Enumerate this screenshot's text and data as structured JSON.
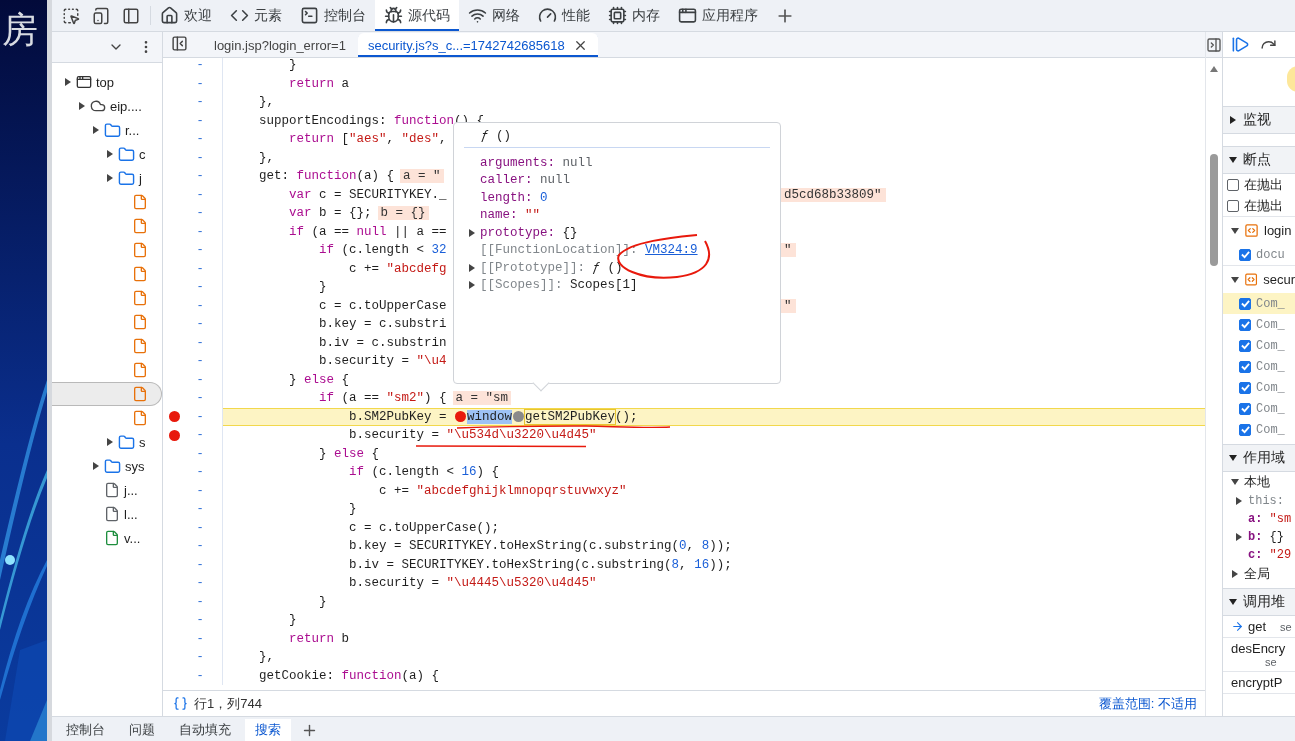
{
  "desktop": {
    "glyph": "房"
  },
  "toolbar": {
    "tabs": [
      {
        "kind": "welcome",
        "label": "欢迎",
        "selected": false
      },
      {
        "kind": "elements",
        "label": "元素",
        "selected": false
      },
      {
        "kind": "console",
        "label": "控制台",
        "selected": false
      },
      {
        "kind": "sources",
        "label": "源代码",
        "selected": true
      },
      {
        "kind": "network",
        "label": "网络",
        "selected": false
      },
      {
        "kind": "performance",
        "label": "性能",
        "selected": false
      },
      {
        "kind": "memory",
        "label": "内存",
        "selected": false
      },
      {
        "kind": "application",
        "label": "应用程序",
        "selected": false
      }
    ]
  },
  "navigator": {
    "tree": [
      {
        "kind": "frame",
        "label": "top",
        "selected": false,
        "children": [
          {
            "kind": "domain",
            "label": "eip....",
            "selected": false,
            "children": [
              {
                "kind": "folder",
                "label": "r...",
                "selected": false,
                "children": [
                  {
                    "kind": "folder",
                    "label": "c",
                    "selected": false
                  },
                  {
                    "kind": "folder",
                    "label": "j",
                    "selected": false,
                    "children": [
                      {
                        "kind": "file",
                        "color": "#e8710a",
                        "selected": false
                      },
                      {
                        "kind": "file",
                        "color": "#e8710a",
                        "selected": false
                      },
                      {
                        "kind": "file",
                        "color": "#e8710a",
                        "selected": false
                      },
                      {
                        "kind": "file",
                        "color": "#e8710a",
                        "selected": false
                      },
                      {
                        "kind": "file",
                        "color": "#e8710a",
                        "selected": false
                      },
                      {
                        "kind": "file",
                        "color": "#e8710a",
                        "selected": false
                      },
                      {
                        "kind": "file",
                        "color": "#e8710a",
                        "selected": false
                      },
                      {
                        "kind": "file",
                        "color": "#e8710a",
                        "selected": false
                      },
                      {
                        "kind": "file",
                        "color": "#e8710a",
                        "selected": true
                      },
                      {
                        "kind": "file",
                        "color": "#e8710a",
                        "selected": false
                      }
                    ]
                  },
                  {
                    "kind": "folder",
                    "label": "s",
                    "selected": false
                  }
                ]
              },
              {
                "kind": "folder",
                "label": "sys",
                "selected": false
              },
              {
                "kind": "file",
                "label": "j...",
                "color": "#5f6368",
                "selected": false
              },
              {
                "kind": "file",
                "label": "l...",
                "color": "#5f6368",
                "selected": false
              },
              {
                "kind": "file",
                "label": "v...",
                "color": "#1e8e3e",
                "selected": false
              }
            ]
          }
        ]
      }
    ]
  },
  "editor": {
    "tabs": [
      {
        "label": "login.jsp?login_error=1",
        "selected": false
      },
      {
        "label": "security.js?s_c...=1742742685618",
        "selected": true
      }
    ],
    "lines": [
      {
        "gutter": "-",
        "breakpoint": false,
        "current": false,
        "tokens": [
          {
            "kind": "plain",
            "text": "        }"
          }
        ]
      },
      {
        "gutter": "-",
        "breakpoint": false,
        "current": false,
        "tokens": [
          {
            "kind": "keyword",
            "text": "        return"
          },
          {
            "kind": "plain",
            "text": " a"
          }
        ]
      },
      {
        "gutter": "-",
        "breakpoint": false,
        "current": false,
        "tokens": [
          {
            "kind": "plain",
            "text": "    },"
          }
        ]
      },
      {
        "gutter": "-",
        "breakpoint": false,
        "current": false,
        "tokens": [
          {
            "kind": "plain",
            "text": "    supportEncodings: "
          },
          {
            "kind": "keyword",
            "text": "function"
          },
          {
            "kind": "plain",
            "text": "() {"
          }
        ]
      },
      {
        "gutter": "-",
        "breakpoint": false,
        "current": false,
        "tokens": [
          {
            "kind": "keyword",
            "text": "        return"
          },
          {
            "kind": "plain",
            "text": " ["
          },
          {
            "kind": "string",
            "text": "\"aes\""
          },
          {
            "kind": "plain",
            "text": ", "
          },
          {
            "kind": "string",
            "text": "\"des\""
          },
          {
            "kind": "plain",
            "text": ","
          }
        ]
      },
      {
        "gutter": "-",
        "breakpoint": false,
        "current": false,
        "tokens": [
          {
            "kind": "plain",
            "text": "    },"
          }
        ]
      },
      {
        "gutter": "-",
        "breakpoint": false,
        "current": false,
        "tokens": [
          {
            "kind": "plain",
            "text": "    get: "
          },
          {
            "kind": "keyword",
            "text": "function"
          },
          {
            "kind": "plain",
            "text": "(a) {"
          },
          {
            "kind": "value",
            "text": "a = \""
          }
        ]
      },
      {
        "gutter": "-",
        "breakpoint": false,
        "current": false,
        "tokens": [
          {
            "kind": "keyword",
            "text": "        var"
          },
          {
            "kind": "plain",
            "text": " c = SECURITYKEY._"
          },
          {
            "kind": "far-value",
            "text": "d5cd68b33809\""
          }
        ]
      },
      {
        "gutter": "-",
        "breakpoint": false,
        "current": false,
        "tokens": [
          {
            "kind": "keyword",
            "text": "        var"
          },
          {
            "kind": "plain",
            "text": " b = {};"
          },
          {
            "kind": "value",
            "text": "b = {}"
          }
        ]
      },
      {
        "gutter": "-",
        "breakpoint": false,
        "current": false,
        "tokens": [
          {
            "kind": "keyword",
            "text": "        if"
          },
          {
            "kind": "plain",
            "text": " (a == "
          },
          {
            "kind": "keyword",
            "text": "null"
          },
          {
            "kind": "plain",
            "text": " || a =="
          }
        ]
      },
      {
        "gutter": "-",
        "breakpoint": false,
        "current": false,
        "tokens": [
          {
            "kind": "keyword",
            "text": "            if"
          },
          {
            "kind": "plain",
            "text": " (c.length < "
          },
          {
            "kind": "number",
            "text": "32"
          },
          {
            "kind": "far-value",
            "text": "\""
          }
        ]
      },
      {
        "gutter": "-",
        "breakpoint": false,
        "current": false,
        "tokens": [
          {
            "kind": "plain",
            "text": "                c += "
          },
          {
            "kind": "string",
            "text": "\"abcdefg"
          }
        ]
      },
      {
        "gutter": "-",
        "breakpoint": false,
        "current": false,
        "tokens": [
          {
            "kind": "plain",
            "text": "            }"
          }
        ]
      },
      {
        "gutter": "-",
        "breakpoint": false,
        "current": false,
        "tokens": [
          {
            "kind": "plain",
            "text": "            c = c.toUpperCase"
          },
          {
            "kind": "far-value",
            "text": "\""
          }
        ]
      },
      {
        "gutter": "-",
        "breakpoint": false,
        "current": false,
        "tokens": [
          {
            "kind": "plain",
            "text": "            b.key = c.substri"
          }
        ]
      },
      {
        "gutter": "-",
        "breakpoint": false,
        "current": false,
        "tokens": [
          {
            "kind": "plain",
            "text": "            b.iv = c.substrin"
          }
        ]
      },
      {
        "gutter": "-",
        "breakpoint": false,
        "current": false,
        "tokens": [
          {
            "kind": "plain",
            "text": "            b.security = "
          },
          {
            "kind": "string",
            "text": "\"\\u4"
          }
        ]
      },
      {
        "gutter": "-",
        "breakpoint": false,
        "current": false,
        "tokens": [
          {
            "kind": "plain",
            "text": "        } "
          },
          {
            "kind": "keyword",
            "text": "else"
          },
          {
            "kind": "plain",
            "text": " {"
          }
        ]
      },
      {
        "gutter": "-",
        "breakpoint": false,
        "current": false,
        "tokens": [
          {
            "kind": "keyword",
            "text": "            if"
          },
          {
            "kind": "plain",
            "text": " (a == "
          },
          {
            "kind": "string",
            "text": "\"sm2\""
          },
          {
            "kind": "plain",
            "text": ") {"
          },
          {
            "kind": "value",
            "text": "a = \"sm"
          }
        ]
      },
      {
        "gutter": "-",
        "breakpoint": true,
        "current": true,
        "tokens": [
          {
            "kind": "plain",
            "text": "                b.SM2PubKey = "
          },
          {
            "kind": "marker",
            "active": true
          },
          {
            "kind": "selection",
            "text": "window"
          },
          {
            "kind": "marker",
            "active": false
          },
          {
            "kind": "match",
            "text": "getSM2PubKey"
          },
          {
            "kind": "plain",
            "text": "();"
          }
        ]
      },
      {
        "gutter": "-",
        "breakpoint": true,
        "current": false,
        "tokens": [
          {
            "kind": "plain",
            "text": "                b.security = "
          },
          {
            "kind": "string",
            "text": "\"\\u534d\\u3220\\u4d45\""
          }
        ]
      },
      {
        "gutter": "-",
        "breakpoint": false,
        "current": false,
        "tokens": [
          {
            "kind": "plain",
            "text": "            } "
          },
          {
            "kind": "keyword",
            "text": "else"
          },
          {
            "kind": "plain",
            "text": " {"
          }
        ]
      },
      {
        "gutter": "-",
        "breakpoint": false,
        "current": false,
        "tokens": [
          {
            "kind": "keyword",
            "text": "                if"
          },
          {
            "kind": "plain",
            "text": " (c.length < "
          },
          {
            "kind": "number",
            "text": "16"
          },
          {
            "kind": "plain",
            "text": ") {"
          }
        ]
      },
      {
        "gutter": "-",
        "breakpoint": false,
        "current": false,
        "tokens": [
          {
            "kind": "plain",
            "text": "                    c += "
          },
          {
            "kind": "string",
            "text": "\"abcdefghijklmnopqrstuvwxyz\""
          }
        ]
      },
      {
        "gutter": "-",
        "breakpoint": false,
        "current": false,
        "tokens": [
          {
            "kind": "plain",
            "text": "                }"
          }
        ]
      },
      {
        "gutter": "-",
        "breakpoint": false,
        "current": false,
        "tokens": [
          {
            "kind": "plain",
            "text": "                c = c.toUpperCase();"
          }
        ]
      },
      {
        "gutter": "-",
        "breakpoint": false,
        "current": false,
        "tokens": [
          {
            "kind": "plain",
            "text": "                b.key = SECURITYKEY.toHexString(c.substring("
          },
          {
            "kind": "number",
            "text": "0"
          },
          {
            "kind": "plain",
            "text": ", "
          },
          {
            "kind": "number",
            "text": "8"
          },
          {
            "kind": "plain",
            "text": "));"
          }
        ]
      },
      {
        "gutter": "-",
        "breakpoint": false,
        "current": false,
        "tokens": [
          {
            "kind": "plain",
            "text": "                b.iv = SECURITYKEY.toHexString(c.substring("
          },
          {
            "kind": "number",
            "text": "8"
          },
          {
            "kind": "plain",
            "text": ", "
          },
          {
            "kind": "number",
            "text": "16"
          },
          {
            "kind": "plain",
            "text": "));"
          }
        ]
      },
      {
        "gutter": "-",
        "breakpoint": false,
        "current": false,
        "tokens": [
          {
            "kind": "plain",
            "text": "                b.security = "
          },
          {
            "kind": "string",
            "text": "\"\\u4445\\u5320\\u4d45\""
          }
        ]
      },
      {
        "gutter": "-",
        "breakpoint": false,
        "current": false,
        "tokens": [
          {
            "kind": "plain",
            "text": "            }"
          }
        ]
      },
      {
        "gutter": "-",
        "breakpoint": false,
        "current": false,
        "tokens": [
          {
            "kind": "plain",
            "text": "        }"
          }
        ]
      },
      {
        "gutter": "-",
        "breakpoint": false,
        "current": false,
        "tokens": [
          {
            "kind": "keyword",
            "text": "        return"
          },
          {
            "kind": "plain",
            "text": " b"
          }
        ]
      },
      {
        "gutter": "-",
        "breakpoint": false,
        "current": false,
        "tokens": [
          {
            "kind": "plain",
            "text": "    },"
          }
        ]
      },
      {
        "gutter": "-",
        "breakpoint": false,
        "current": false,
        "tokens": [
          {
            "kind": "plain",
            "text": "    getCookie: "
          },
          {
            "kind": "keyword",
            "text": "function"
          },
          {
            "kind": "plain",
            "text": "(a) {"
          }
        ]
      }
    ],
    "popover": {
      "title": "*ƒ* ()",
      "properties": [
        {
          "key": "arguments:",
          "value": "null",
          "kind": "null",
          "expandable": false,
          "internal": false
        },
        {
          "key": "caller:",
          "value": "null",
          "kind": "null",
          "expandable": false,
          "internal": false
        },
        {
          "key": "length:",
          "value": "0",
          "kind": "number",
          "expandable": false,
          "internal": false
        },
        {
          "key": "name:",
          "value": "\"\"",
          "kind": "string",
          "expandable": false,
          "internal": false
        },
        {
          "key": "prototype:",
          "value": "{}",
          "kind": "object",
          "expandable": true,
          "internal": false
        },
        {
          "key": "[[FunctionLocation]]:",
          "value": "VM324:9",
          "kind": "link",
          "expandable": false,
          "internal": true
        },
        {
          "key": "[[Prototype]]:",
          "value": "*ƒ* ()",
          "kind": "function",
          "expandable": true,
          "internal": true
        },
        {
          "key": "[[Scopes]]:",
          "value": "Scopes[1]",
          "kind": "object",
          "expandable": true,
          "internal": true
        }
      ]
    },
    "status": {
      "position": "行1，列744",
      "coverage": "覆盖范围: 不适用"
    }
  },
  "debugger": {
    "sections": [
      {
        "kind": "watch",
        "title": "监视",
        "expanded": false
      },
      {
        "kind": "breakpoints",
        "title": "断点",
        "expanded": true,
        "options": [
          {
            "label": "在抛出",
            "checked": false
          },
          {
            "label": "在抛出",
            "checked": false
          }
        ],
        "files": [
          {
            "name": "login",
            "breakpoints": [
              {
                "label": "docu",
                "checked": true,
                "selected": false
              }
            ]
          },
          {
            "name": "secur",
            "breakpoints": [
              {
                "label": "Com_",
                "checked": true,
                "selected": true
              },
              {
                "label": "Com_",
                "checked": true,
                "selected": false
              },
              {
                "label": "Com_",
                "checked": true,
                "selected": false
              },
              {
                "label": "Com_",
                "checked": true,
                "selected": false
              },
              {
                "label": "Com_",
                "checked": true,
                "selected": false
              },
              {
                "label": "Com_",
                "checked": true,
                "selected": false
              },
              {
                "label": "Com_",
                "checked": true,
                "selected": false
              }
            ]
          }
        ]
      },
      {
        "kind": "scope",
        "title": "作用域",
        "expanded": true,
        "groups": [
          {
            "label": "本地",
            "expanded": true,
            "entries": [
              {
                "key": "this:",
                "kind": "internal",
                "expandable": true
              },
              {
                "key": "a:",
                "value": "\"sm",
                "kind": "string",
                "expandable": false
              },
              {
                "key": "b:",
                "value": "{}",
                "kind": "object",
                "expandable": true
              },
              {
                "key": "c:",
                "value": "\"29",
                "kind": "string",
                "expandable": false
              }
            ]
          },
          {
            "label": "全局",
            "expanded": false
          }
        ]
      },
      {
        "kind": "callstack",
        "title": "调用堆",
        "expanded": true,
        "frames": [
          {
            "name": "get",
            "location": "se",
            "selected": true
          },
          {
            "name": "desEncry",
            "location": "se",
            "selected": false
          },
          {
            "name": "encryptP",
            "selected": false
          }
        ]
      }
    ]
  },
  "drawer": {
    "tabs": [
      {
        "label": "控制台",
        "selected": false
      },
      {
        "label": "问题",
        "selected": false
      },
      {
        "label": "自动填充",
        "selected": false
      },
      {
        "label": "搜索",
        "selected": true
      }
    ]
  }
}
